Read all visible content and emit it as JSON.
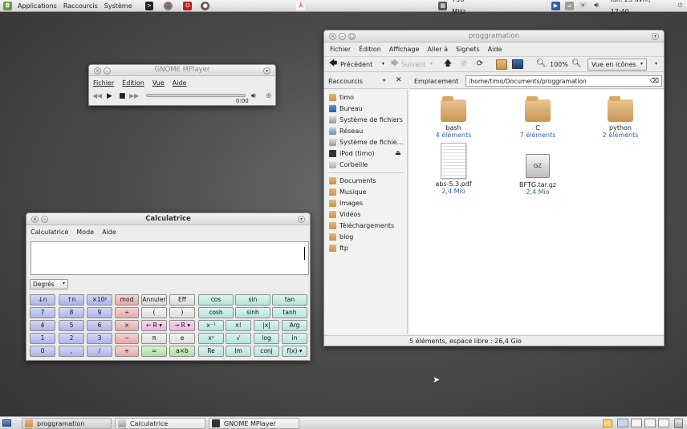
{
  "top_panel": {
    "menus": [
      "Applications",
      "Raccourcis",
      "Système"
    ],
    "cpu_freq": "798 MHz",
    "clock": "lun. 25 avril, 17:40"
  },
  "mplayer": {
    "title": "GNOME MPlayer",
    "menus": [
      "Fichier",
      "Édition",
      "Vue",
      "Aide"
    ],
    "time": "0:00"
  },
  "file_manager": {
    "title": "proggramation",
    "menus": [
      "Fichier",
      "Édition",
      "Affichage",
      "Aller à",
      "Signets",
      "Aide"
    ],
    "toolbar": {
      "back": "Précédent",
      "forward": "Suivant",
      "zoom": "100%",
      "view_mode": "Vue en icônes"
    },
    "sidebar_title": "Raccourcis",
    "location_label": "Emplacement",
    "location_value": "/home/timo/Documents/proggramation",
    "places": [
      "timo",
      "Bureau",
      "Système de fichiers",
      "Réseau",
      "Système de fichie…",
      "iPod (timo)",
      "Corbeille"
    ],
    "bookmarks": [
      "Documents",
      "Musique",
      "Images",
      "Vidéos",
      "Téléchargements",
      "blog",
      "ftp"
    ],
    "items": [
      {
        "name": "bash",
        "info": "4 éléments"
      },
      {
        "name": "C",
        "info": "7 éléments"
      },
      {
        "name": "python",
        "info": "2 éléments"
      },
      {
        "name": "abs-5.3.pdf",
        "info": "2,4 Mio"
      },
      {
        "name": "BFTG.tar.gz",
        "info": "2,4 Mio"
      }
    ],
    "status": "5 éléments, espace libre : 26,4 Gio"
  },
  "calculator": {
    "title": "Calculatrice",
    "menus": [
      "Calculatrice",
      "Mode",
      "Aide"
    ],
    "angle_unit": "Degrés",
    "buttons": [
      [
        "↓n",
        "↑n",
        "×10ʸ",
        "mod",
        "Annuler",
        "Eff",
        "cos",
        "sin",
        "tan"
      ],
      [
        "7",
        "8",
        "9",
        "÷",
        "(",
        ")",
        "cosh",
        "sinh",
        "tanh"
      ],
      [
        "4",
        "5",
        "6",
        "×",
        "← R ▾",
        "→ R ▾",
        "x⁻¹",
        "x!",
        "|x|",
        "Arg"
      ],
      [
        "1",
        "2",
        "3",
        "−",
        "π",
        "e",
        "xʸ",
        "√",
        "log",
        "ln"
      ],
      [
        "0",
        ",",
        "/",
        "+",
        "=",
        "a×b",
        "Re",
        "Im",
        "conj",
        "f(x) ▾"
      ]
    ]
  },
  "taskbar": {
    "tasks": [
      "proggramation",
      "Calculatrice",
      "GNOME MPlayer"
    ]
  }
}
